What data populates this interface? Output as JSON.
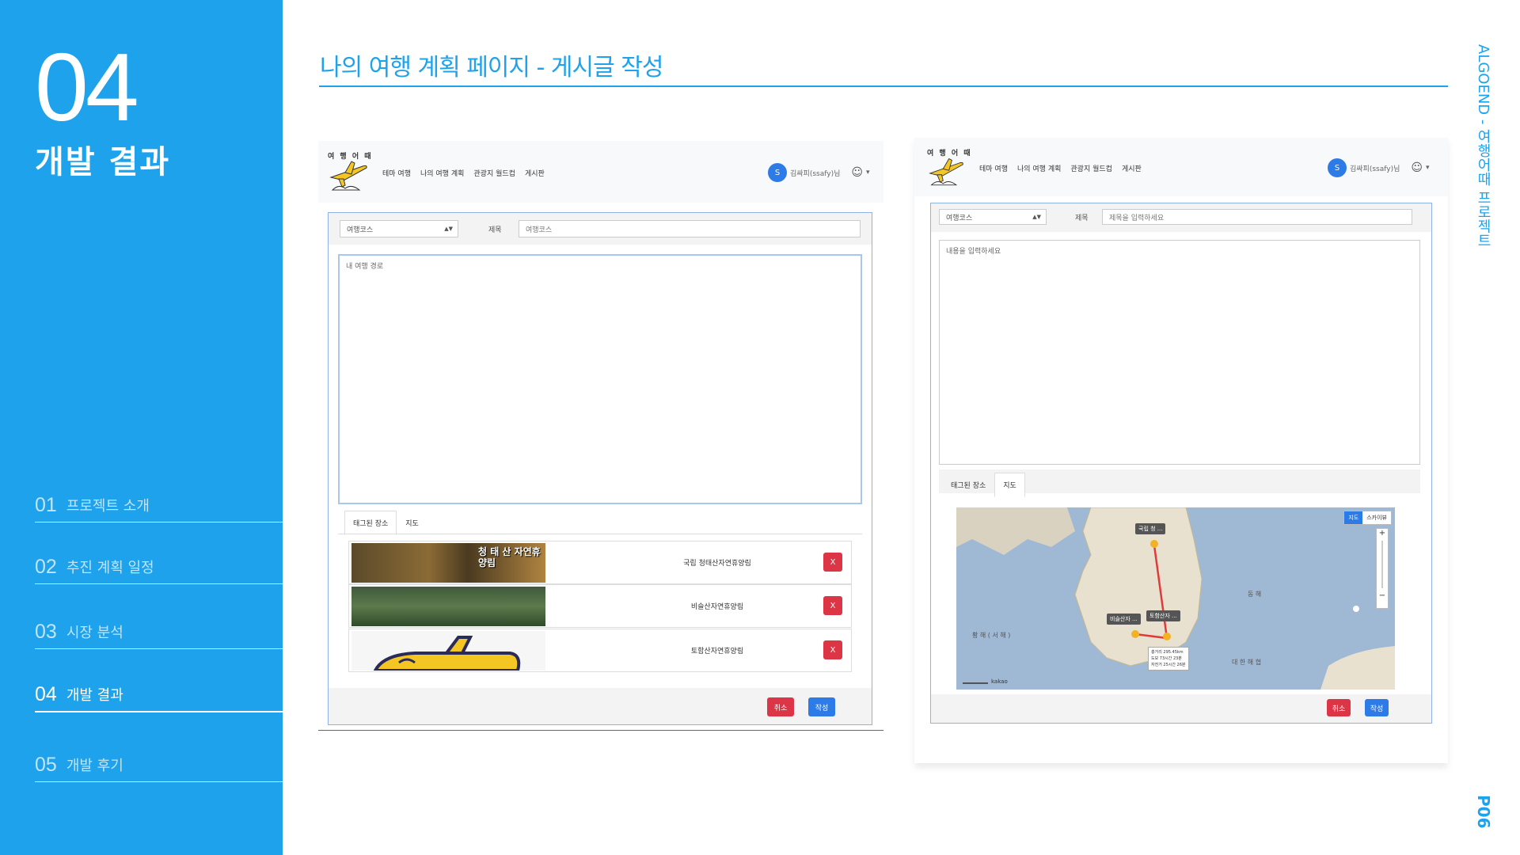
{
  "slide": {
    "section_number": "04",
    "section_title": "개발 결과",
    "page_title": "나의 여행 계획 페이지 - 게시글 작성",
    "project_label": "ALGOEND - 여행어때 프로젝트",
    "page_number": "P06"
  },
  "menu": [
    {
      "num": "01",
      "label": "프로젝트 소개"
    },
    {
      "num": "02",
      "label": "추진 계획 일정"
    },
    {
      "num": "03",
      "label": "시장 분석"
    },
    {
      "num": "04",
      "label": "개발 결과"
    },
    {
      "num": "05",
      "label": "개발 후기"
    }
  ],
  "app": {
    "logo_text": "여 행 어 때",
    "nav": [
      "테마 여행",
      "나의 여행 계획",
      "관광지 월드컵",
      "게시판"
    ],
    "user_initial": "S",
    "user_name": "김싸피(ssafy)님",
    "user_caret": "▾"
  },
  "left_shot": {
    "select_value": "여행코스",
    "title_label": "제목",
    "title_value": "여행코스",
    "content": "내 여행 경로",
    "tabs": [
      "태그된 장소",
      "지도"
    ],
    "places": [
      {
        "name": "국립 청태산자연휴양림",
        "image_text": "청 태 산 자연휴양림"
      },
      {
        "name": "비슬산자연휴양림",
        "image_text": ""
      },
      {
        "name": "토함산자연휴양림",
        "image_text": ""
      }
    ],
    "delete_label": "X",
    "cancel_label": "취소",
    "submit_label": "작성"
  },
  "right_shot": {
    "select_value": "여행코스",
    "title_label": "제목",
    "title_placeholder": "제목을 입력하세요",
    "content_placeholder": "내용을 입력하세요",
    "tabs": [
      "태그된 장소",
      "지도"
    ],
    "map": {
      "toggle": [
        "지도",
        "스카이뷰"
      ],
      "markers": [
        "국립 청 ...",
        "비슬산자 ...",
        "토함산자 ..."
      ],
      "sea_labels": [
        "동 해",
        "황 해 ( 서 해 )",
        "대 한 해 협"
      ],
      "info_lines": [
        "총거리 295.45km",
        "도보 73시간 23분",
        "자전거 25시간 26분"
      ],
      "scale": "kakao",
      "zoom_in": "+",
      "zoom_out": "−"
    },
    "cancel_label": "취소",
    "submit_label": "작성"
  }
}
